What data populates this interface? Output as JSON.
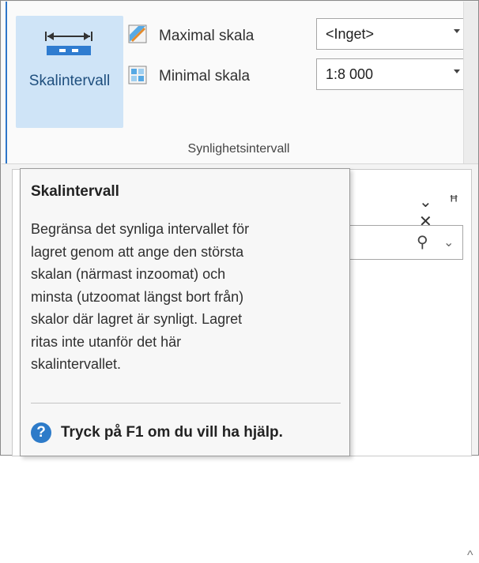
{
  "ribbon": {
    "scale_button_label": "Skalintervall",
    "max_scale_label": "Maximal skala",
    "min_scale_label": "Minimal skala",
    "max_scale_value": "<Inget>",
    "min_scale_value": "1:8 000",
    "group_label": "Synlighetsintervall"
  },
  "pane": {
    "icons": [
      "chevron-down-icon",
      "pin-icon",
      "close-icon"
    ],
    "search_icon": "magnifier-icon"
  },
  "tooltip": {
    "title": "Skalintervall",
    "body_lines": [
      "Begränsa det synliga intervallet för",
      "lagret genom att ange den största",
      "skalan (närmast inzoomat) och",
      "minsta (utzoomat längst bort från)",
      "skalor där lagret är synligt. Lagret",
      "ritas inte utanför det här",
      "skalintervallet."
    ],
    "help_text": "Tryck på F1 om du vill ha hjälp.",
    "help_icon_glyph": "?"
  },
  "colors": {
    "accent_blue": "#2d7bc9",
    "button_highlight": "#cfe4f7"
  }
}
